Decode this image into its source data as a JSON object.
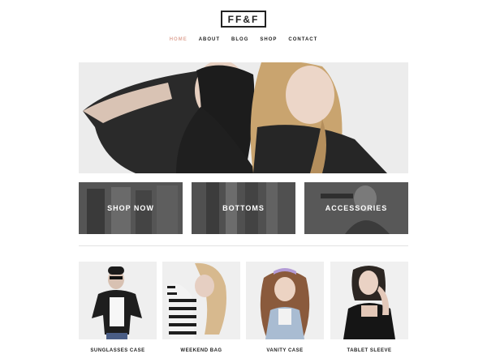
{
  "header": {
    "logo": "FF&F"
  },
  "nav": {
    "items": [
      "HOME",
      "ABOUT",
      "BLOG",
      "SHOP",
      "CONTACT"
    ],
    "active": "HOME"
  },
  "categories": [
    {
      "label": "SHOP NOW"
    },
    {
      "label": "BOTTOMS"
    },
    {
      "label": "ACCESSORIES"
    }
  ],
  "products": [
    {
      "name": "SUNGLASSES CASE"
    },
    {
      "name": "WEEKEND BAG"
    },
    {
      "name": "VANITY CASE"
    },
    {
      "name": "TABLET SLEEVE"
    }
  ],
  "colors": {
    "accent": "#e0a99b",
    "text": "#222222",
    "divider": "#e2e2e2"
  }
}
